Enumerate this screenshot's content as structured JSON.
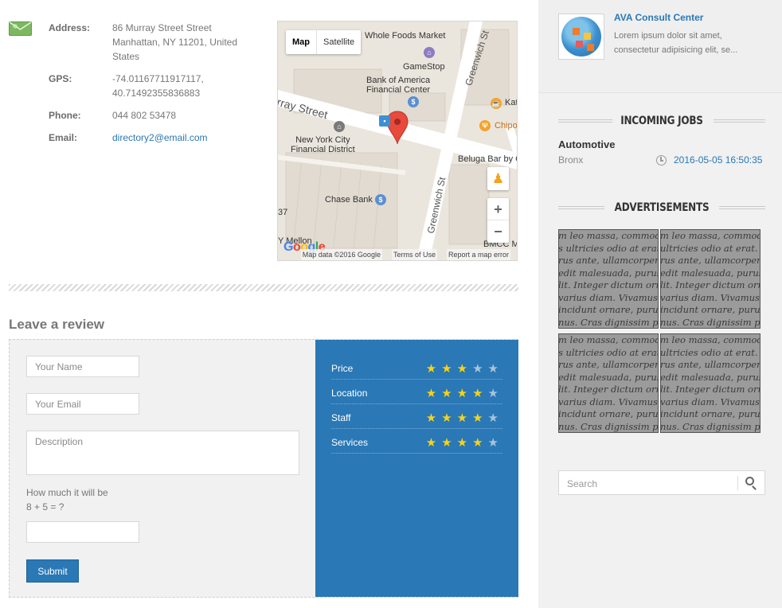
{
  "listing": {
    "address_label": "Address:",
    "address_value": "86 Murray Street Street Manhattan, NY 11201, United States",
    "gps_label": "GPS:",
    "gps_value": "-74.01167711917117, 40.71492355836883",
    "phone_label": "Phone:",
    "phone_value": "044 802 53478",
    "email_label": "Email:",
    "email_value": "directory2@email.com"
  },
  "map": {
    "type_map": "Map",
    "type_satellite": "Satellite",
    "labels": {
      "whole_foods": "Whole Foods Market",
      "gamestop": "GameStop",
      "bank_of_america": "Bank of America\nFinancial Center",
      "murray_street": "rray Street",
      "greenwich_top": "Greenwich St",
      "greenwich_bottom": "Greenwich St",
      "nyc_financial": "New York City\nFinancial District",
      "beluga": "Beluga Bar by C",
      "chase": "Chase Bank",
      "kat": "Kat",
      "chipotle": "Chipo",
      "mellon": "Y Mellon",
      "bmcc": "BMCC M",
      "num_37": "37"
    },
    "google": "Google",
    "footer_data": "Map data ©2016 Google",
    "footer_terms": "Terms of Use",
    "footer_report": "Report a map error",
    "zoom_in": "+",
    "zoom_out": "−"
  },
  "review": {
    "title": "Leave a review",
    "name_placeholder": "Your Name",
    "email_placeholder": "Your Email",
    "description_placeholder": "Description",
    "captcha_line1": "How much it will be",
    "captcha_line2": "8 + 5 = ?",
    "submit_label": "Submit",
    "ratings": [
      {
        "label": "Price",
        "stars": 3
      },
      {
        "label": "Location",
        "stars": 4
      },
      {
        "label": "Staff",
        "stars": 4
      },
      {
        "label": "Services",
        "stars": 4
      }
    ],
    "max_stars": 5,
    "colors": {
      "panel": "#2a78b5",
      "star_on": "#f6d21a",
      "star_off": "#a7c3dc"
    }
  },
  "sidebar": {
    "promo_title": "AVA Consult Center",
    "promo_text": "Lorem ipsum dolor sit amet, consectetur adipisicing elit, se...",
    "incoming_jobs_title": "INCOMING JOBS",
    "job": {
      "title": "Automotive",
      "location": "Bronx",
      "date": "2016-05-05 16:50:35"
    },
    "advertisements_title": "ADVERTISEMENTS",
    "ad_text": "m leo massa, commodo\ns ultricies odio at erat. D\nrus ante, ullamcorper a\nedit malesuada, purus n\nlit. Integer dictum orna\nvarius diam. Vivamus\nincidunt ornare, purus\nnus. Cras dignissim ph",
    "ad_text_right": "m leo massa, commodo\nultricies odio at erat. D\nrus ante, ullamcorper a\nedit malesuada, purus r\nlit. Integer dictum orna\nvarius diam. Vivamus\nincidunt ornare, purus\nnus. Cras dignissim ph",
    "search_placeholder": "Search"
  }
}
